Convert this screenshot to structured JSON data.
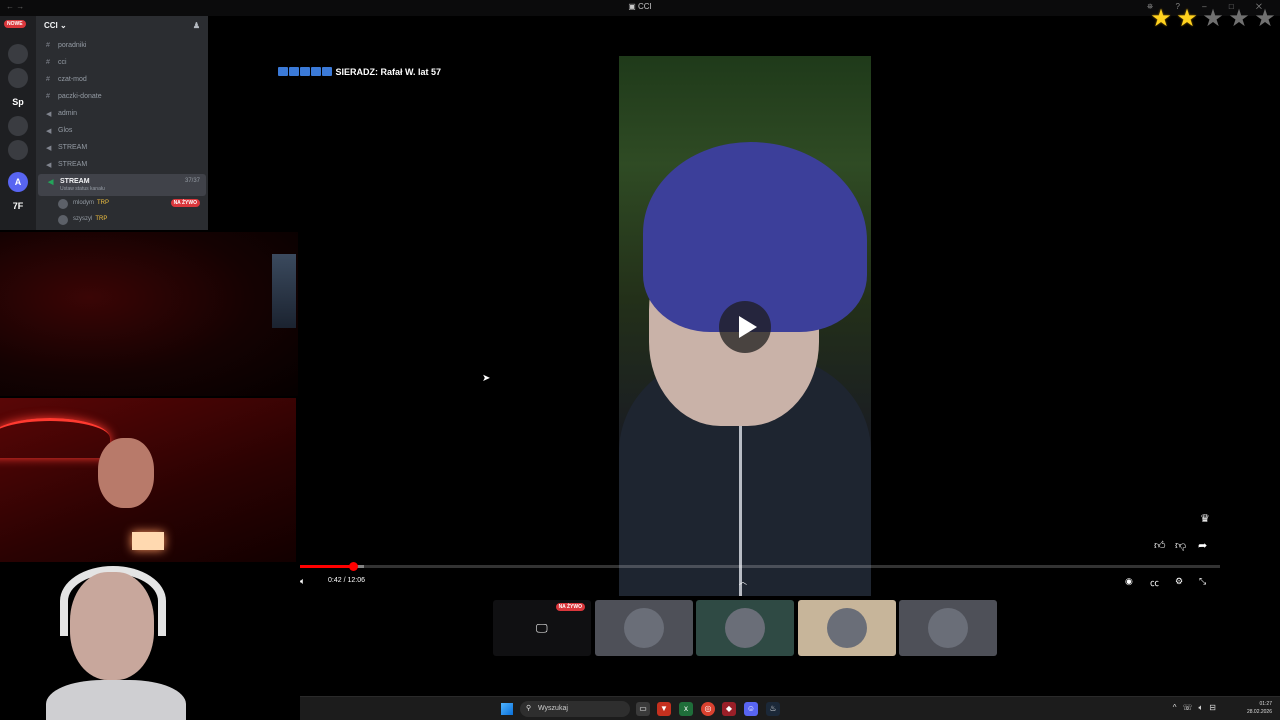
{
  "window": {
    "title": "CCI",
    "title_icon": "discord-icon"
  },
  "stars": {
    "rating": 2,
    "max": 5,
    "on_color": "#ffd21e",
    "off_color": "#707070"
  },
  "discord": {
    "server_badge": "NOWE",
    "server_name": "CCI",
    "servers": [
      "Sp",
      "A",
      "7F"
    ],
    "channels": [
      {
        "name": "poradniki",
        "type": "text"
      },
      {
        "name": "cci",
        "type": "text"
      },
      {
        "name": "czat-mod",
        "type": "text"
      },
      {
        "name": "paczki-donate",
        "type": "text"
      },
      {
        "name": "admin",
        "type": "voice"
      },
      {
        "name": "Glos",
        "type": "voice"
      },
      {
        "name": "STREAM",
        "type": "voice"
      },
      {
        "name": "STREAM",
        "type": "voice"
      }
    ],
    "active_channel": {
      "name": "STREAM",
      "status": "Ustaw status kanału",
      "count": "37/37"
    },
    "members": [
      {
        "name": "mlodym",
        "tag": "TRP",
        "live": "NA ŻYWO"
      },
      {
        "name": "szyszyl",
        "tag": "TRP"
      }
    ]
  },
  "video": {
    "title": "SIERADZ: Rafał W. lat 57",
    "current_time": "0:42",
    "duration": "12:06",
    "time_display": "0:42 / 12:06",
    "progress": 0.058,
    "buffered": 0.07,
    "progress_color": "#ff0000"
  },
  "participants": {
    "live_label": "NA ŻYWO",
    "tiles": [
      {
        "name": "screen-share"
      },
      {
        "name": "participant-2"
      },
      {
        "name": "participant-3"
      },
      {
        "name": "participant-4"
      },
      {
        "name": "participant-5"
      }
    ]
  },
  "taskbar": {
    "search_placeholder": "Wyszukaj",
    "time": "01:27",
    "date": "28.02.2026"
  }
}
